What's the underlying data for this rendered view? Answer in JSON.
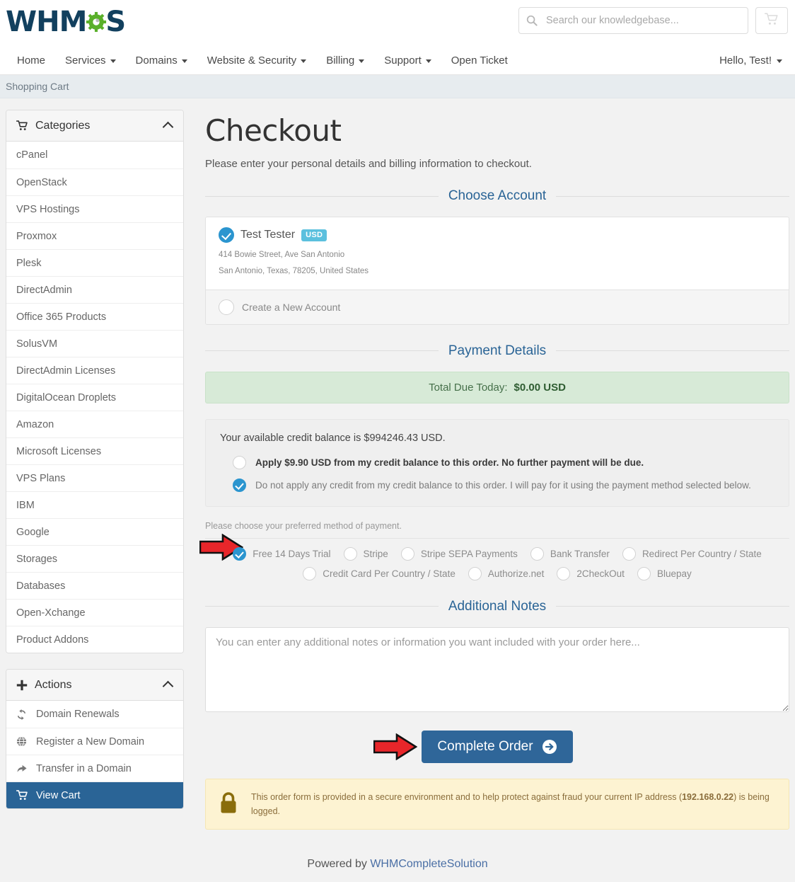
{
  "header": {
    "logo_text_left": "WHM",
    "logo_text_right": "S",
    "logo_icon": "gear-icon",
    "search": {
      "placeholder": "Search our knowledgebase...",
      "value": "",
      "icon": "search-icon"
    },
    "cart_button_icon": "shopping-cart-icon"
  },
  "nav": {
    "items": [
      {
        "label": "Home",
        "has_caret": false
      },
      {
        "label": "Services",
        "has_caret": true
      },
      {
        "label": "Domains",
        "has_caret": true
      },
      {
        "label": "Website & Security",
        "has_caret": true
      },
      {
        "label": "Billing",
        "has_caret": true
      },
      {
        "label": "Support",
        "has_caret": true
      },
      {
        "label": "Open Ticket",
        "has_caret": false
      }
    ],
    "user_menu_label": "Hello, Test!"
  },
  "breadcrumb": {
    "label": "Shopping Cart"
  },
  "sidebar": {
    "categories_panel": {
      "title": "Categories",
      "icon": "shopping-cart-icon",
      "toggle_icon": "chevron-up-icon",
      "items": [
        {
          "label": "cPanel"
        },
        {
          "label": "OpenStack"
        },
        {
          "label": "VPS Hostings"
        },
        {
          "label": "Proxmox"
        },
        {
          "label": "Plesk"
        },
        {
          "label": "DirectAdmin"
        },
        {
          "label": "Office 365 Products"
        },
        {
          "label": "SolusVM"
        },
        {
          "label": "DirectAdmin Licenses"
        },
        {
          "label": "DigitalOcean Droplets"
        },
        {
          "label": "Amazon"
        },
        {
          "label": "Microsoft Licenses"
        },
        {
          "label": "VPS Plans"
        },
        {
          "label": "IBM"
        },
        {
          "label": "Google"
        },
        {
          "label": "Storages"
        },
        {
          "label": "Databases"
        },
        {
          "label": "Open-Xchange"
        },
        {
          "label": "Product Addons"
        }
      ]
    },
    "actions_panel": {
      "title": "Actions",
      "icon": "plus-icon",
      "toggle_icon": "chevron-up-icon",
      "items": [
        {
          "label": "Domain Renewals",
          "icon": "refresh-icon",
          "active": false
        },
        {
          "label": "Register a New Domain",
          "icon": "globe-icon",
          "active": false
        },
        {
          "label": "Transfer in a Domain",
          "icon": "arrow-turn-icon",
          "active": false
        },
        {
          "label": "View Cart",
          "icon": "shopping-cart-icon",
          "active": true
        }
      ]
    }
  },
  "main": {
    "title": "Checkout",
    "lead": "Please enter your personal details and billing information to checkout.",
    "choose_account": {
      "heading": "Choose Account",
      "existing": {
        "name": "Test Tester",
        "currency_badge": "USD",
        "address_line1": "414 Bowie Street, Ave San Antonio",
        "address_line2": "San Antonio, Texas, 78205, United States",
        "selected": true
      },
      "new_account": {
        "label": "Create a New Account",
        "selected": false
      }
    },
    "payment_details": {
      "heading": "Payment Details",
      "total_due_label": "Total Due Today:",
      "total_due_amount": "$0.00 USD",
      "credit_balance_text": "Your available credit balance is $994246.43 USD.",
      "credit_options": [
        {
          "label": "Apply $9.90 USD from my credit balance to this order. No further payment will be due.",
          "selected": false
        },
        {
          "label": "Do not apply any credit from my credit balance to this order. I will pay for it using the payment method selected below.",
          "selected": true
        }
      ],
      "method_hint": "Please choose your preferred method of payment.",
      "methods_row1": [
        {
          "label": "Free 14 Days Trial",
          "selected": true
        },
        {
          "label": "Stripe",
          "selected": false
        },
        {
          "label": "Stripe SEPA Payments",
          "selected": false
        },
        {
          "label": "Bank Transfer",
          "selected": false
        },
        {
          "label": "Redirect Per Country / State",
          "selected": false
        }
      ],
      "methods_row2": [
        {
          "label": "Credit Card Per Country / State",
          "selected": false
        },
        {
          "label": "Authorize.net",
          "selected": false
        },
        {
          "label": "2CheckOut",
          "selected": false
        },
        {
          "label": "Bluepay",
          "selected": false
        }
      ]
    },
    "additional_notes": {
      "heading": "Additional Notes",
      "placeholder": "You can enter any additional notes or information you want included with your order here...",
      "value": ""
    },
    "complete_order": {
      "label": "Complete Order",
      "icon": "arrow-circle-right-icon"
    },
    "secure_notice": {
      "icon": "lock-icon",
      "text_before": "This order form is provided in a secure environment and to help protect against fraud your current IP address (",
      "ip": "192.168.0.22",
      "text_after": ") is being logged."
    }
  },
  "annotations": {
    "arrow_payment_method": "red-arrow-right",
    "arrow_complete_order": "red-arrow-right",
    "arrow_fill": "#e8262a",
    "arrow_stroke": "#111111"
  },
  "footer": {
    "powered_by": "Powered by ",
    "brand": "WHMCompleteSolution"
  },
  "colors": {
    "brand_dark": "#12405e",
    "gear_green": "#5ab02a",
    "link_blue": "#2a6496",
    "radio_blue": "#2b95cf",
    "badge_blue": "#5bc0de",
    "success_bg": "#d7ead7",
    "warning_bg": "#fdf3d2",
    "button_blue": "#2f6699"
  }
}
